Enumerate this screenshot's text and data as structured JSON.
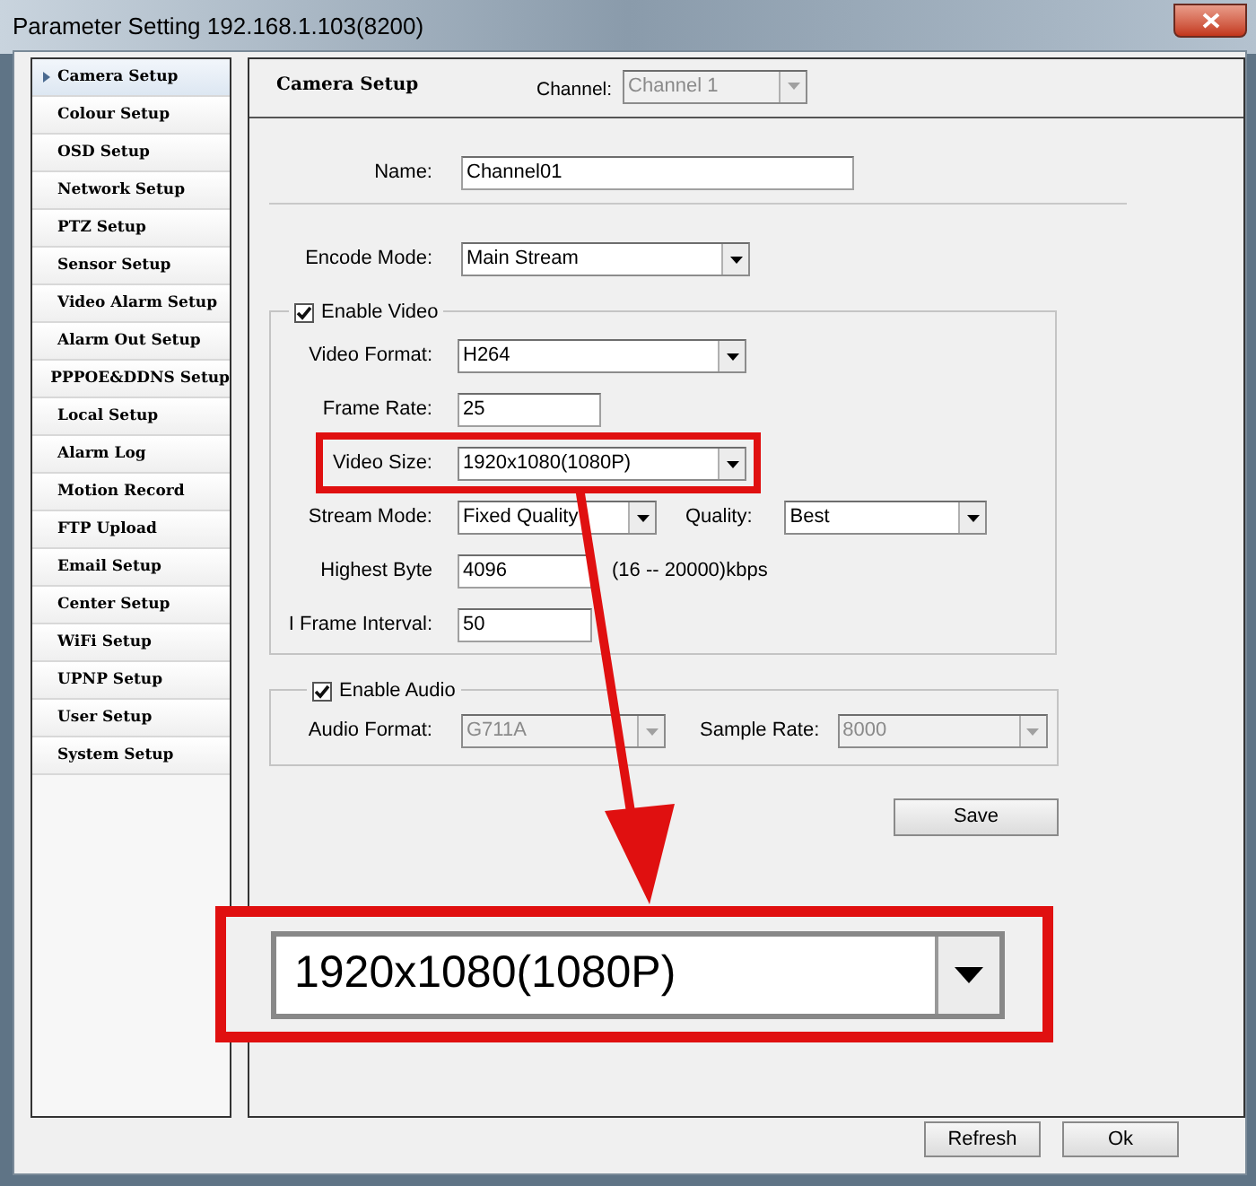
{
  "window": {
    "title": "Parameter Setting 192.168.1.103(8200)"
  },
  "sidebar": {
    "items": [
      {
        "label": "Camera Setup",
        "selected": true
      },
      {
        "label": "Colour Setup",
        "selected": false
      },
      {
        "label": "OSD Setup",
        "selected": false
      },
      {
        "label": "Network Setup",
        "selected": false
      },
      {
        "label": "PTZ Setup",
        "selected": false
      },
      {
        "label": "Sensor Setup",
        "selected": false
      },
      {
        "label": "Video Alarm Setup",
        "selected": false
      },
      {
        "label": "Alarm Out Setup",
        "selected": false
      },
      {
        "label": "PPPOE&DDNS Setup",
        "selected": false
      },
      {
        "label": "Local Setup",
        "selected": false
      },
      {
        "label": "Alarm Log",
        "selected": false
      },
      {
        "label": "Motion Record",
        "selected": false
      },
      {
        "label": "FTP Upload",
        "selected": false
      },
      {
        "label": "Email Setup",
        "selected": false
      },
      {
        "label": "Center Setup",
        "selected": false
      },
      {
        "label": "WiFi Setup",
        "selected": false
      },
      {
        "label": "UPNP Setup",
        "selected": false
      },
      {
        "label": "User Setup",
        "selected": false
      },
      {
        "label": "System Setup",
        "selected": false
      }
    ]
  },
  "panel": {
    "title": "Camera Setup",
    "channel": {
      "label": "Channel:",
      "value": "Channel 1",
      "disabled": true
    }
  },
  "top_rows": [
    {
      "label": "Name:",
      "kind": "text",
      "value": "Channel01",
      "disabled": false
    },
    {
      "label": "Encode Mode:",
      "kind": "select",
      "value": "Main Stream",
      "disabled": false
    }
  ],
  "video_group": {
    "label": "Enable Video",
    "checked": true,
    "rows": [
      {
        "highlighted": false,
        "fields": [
          {
            "label": "Video Format:",
            "kind": "select",
            "value": "H264",
            "disabled": false
          }
        ]
      },
      {
        "highlighted": false,
        "fields": [
          {
            "label": "Frame Rate:",
            "kind": "text",
            "value": "25",
            "disabled": false
          }
        ]
      },
      {
        "highlighted": true,
        "fields": [
          {
            "label": "Video Size:",
            "kind": "select",
            "value": "1920x1080(1080P)",
            "disabled": false
          }
        ]
      },
      {
        "highlighted": false,
        "fields": [
          {
            "label": "Stream Mode:",
            "kind": "select",
            "value": "Fixed Quality",
            "disabled": false
          },
          {
            "label": "Quality:",
            "kind": "select",
            "value": "Best",
            "disabled": false
          }
        ]
      },
      {
        "highlighted": false,
        "fields": [
          {
            "label": "Highest Byte",
            "kind": "text",
            "value": "4096",
            "hint": "(16 -- 20000)kbps",
            "disabled": false
          }
        ]
      },
      {
        "highlighted": false,
        "fields": [
          {
            "label": "I Frame Interval:",
            "kind": "text",
            "value": "50",
            "disabled": false
          }
        ]
      }
    ]
  },
  "audio_group": {
    "label": "Enable Audio",
    "checked": true,
    "fields": [
      {
        "label": "Audio Format:",
        "kind": "select",
        "value": "G711A",
        "disabled": true
      },
      {
        "label": "Sample Rate:",
        "kind": "select",
        "value": "8000",
        "disabled": true
      }
    ]
  },
  "save_button": "Save",
  "callout": {
    "value": "1920x1080(1080P)"
  },
  "footer_buttons": [
    "Refresh",
    "Ok"
  ]
}
